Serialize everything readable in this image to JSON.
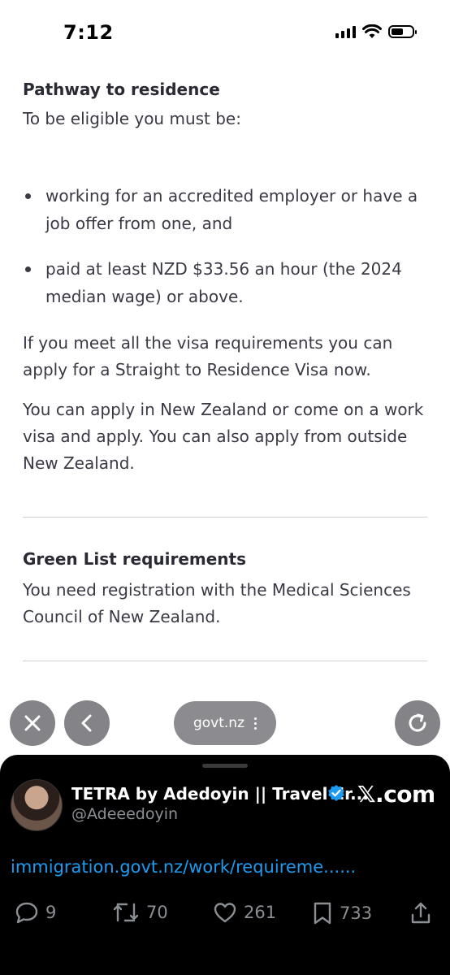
{
  "status_bar": {
    "time": "7:12"
  },
  "article": {
    "heading1": "Pathway to residence",
    "intro": "To be eligible you must be:",
    "requirements": [
      "working for an accredited employer or have a job offer from one, and",
      "paid at least NZD $33.56 an hour (the 2024 median wage) or above."
    ],
    "para1": "If you meet all the visa requirements you can apply for a Straight to Residence Visa now.",
    "para2": "You can apply in New Zealand or come on a work visa and apply. You can also apply from outside New Zealand.",
    "heading2": "Green List requirements",
    "para3": "You need registration with the Medical Sciences Council of New Zealand."
  },
  "browser": {
    "url": "govt.nz"
  },
  "tweet": {
    "author_name": "TETRA by Adedoyin || Travel Er...",
    "handle": "@Adeeedoyin",
    "brand": "𝕏.com",
    "link": "immigration.govt.nz/work/requireme......",
    "replies": "9",
    "reposts": "70",
    "likes": "261",
    "bookmarks": "733"
  },
  "colors": {
    "link": "#1d9bf0",
    "verified": "#1d9bf0",
    "text": "#3a3a45",
    "tweet_bg": "#000000"
  }
}
